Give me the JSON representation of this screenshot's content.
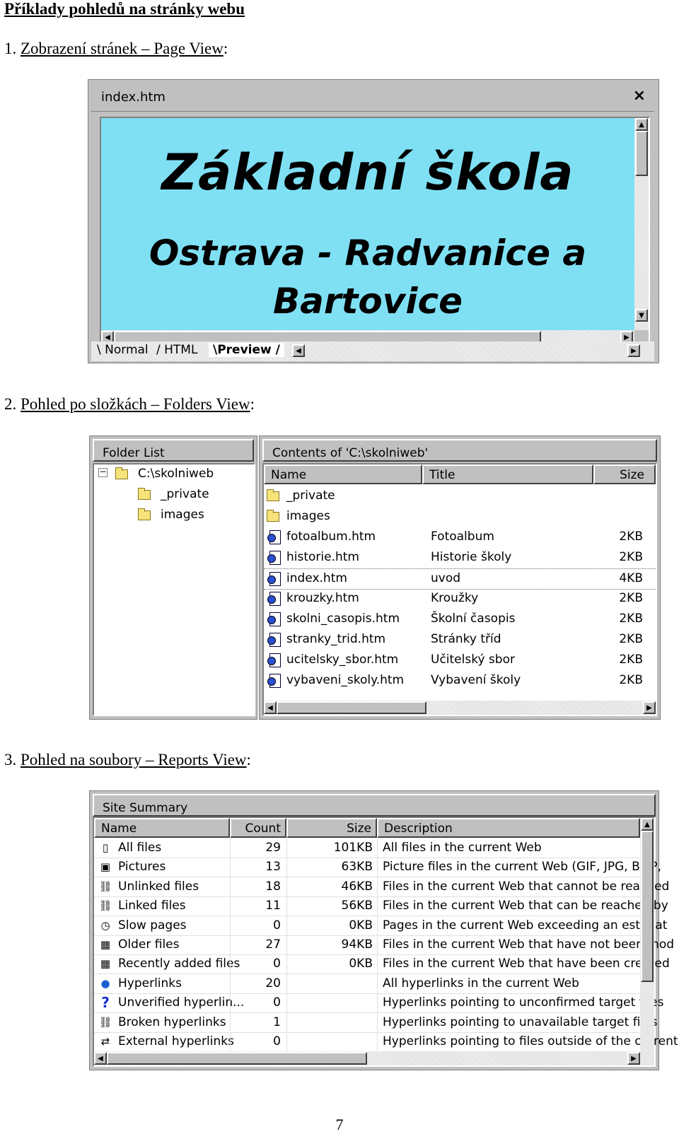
{
  "doc_title": "Příklady pohledů na stránky webu",
  "sections": [
    {
      "num": "1. ",
      "label": "Zobrazení stránek – Page View",
      "suffix": ":"
    },
    {
      "num": "2. ",
      "label": "Pohled po složkách – Folders View",
      "suffix": ":"
    },
    {
      "num": "3. ",
      "label": "Pohled na soubory – Reports View",
      "suffix": ":"
    }
  ],
  "page_view": {
    "window_title": "index.htm",
    "close_glyph": "×",
    "heading": "Základní škola",
    "line2": "Ostrava - Radvanice a",
    "line3": "Bartovice",
    "background_color": "#7fe0f4",
    "tabs": [
      "Normal",
      "HTML",
      "Preview"
    ],
    "active_tab": "Preview"
  },
  "folders_view": {
    "folder_list_title": "Folder List",
    "root": "C:\\skolniweb",
    "tree": [
      "_private",
      "images"
    ],
    "contents_title": "Contents of 'C:\\skolniweb'",
    "columns": [
      "Name",
      "Title",
      "Size"
    ],
    "rows": [
      {
        "name": "_private",
        "title": "",
        "size": "",
        "kind": "folder"
      },
      {
        "name": "images",
        "title": "",
        "size": "",
        "kind": "folder"
      },
      {
        "name": "fotoalbum.htm",
        "title": "Fotoalbum",
        "size": "2KB",
        "kind": "page"
      },
      {
        "name": "historie.htm",
        "title": "Historie školy",
        "size": "2KB",
        "kind": "page"
      },
      {
        "name": "index.htm",
        "title": "uvod",
        "size": "4KB",
        "kind": "home"
      },
      {
        "name": "krouzky.htm",
        "title": "Kroužky",
        "size": "2KB",
        "kind": "page"
      },
      {
        "name": "skolni_casopis.htm",
        "title": "Školní časopis",
        "size": "2KB",
        "kind": "page"
      },
      {
        "name": "stranky_trid.htm",
        "title": "Stránky tříd",
        "size": "2KB",
        "kind": "page"
      },
      {
        "name": "ucitelsky_sbor.htm",
        "title": "Učitelský sbor",
        "size": "2KB",
        "kind": "page"
      },
      {
        "name": "vybaveni_skoly.htm",
        "title": "Vybavení školy",
        "size": "2KB",
        "kind": "page"
      }
    ]
  },
  "reports_view": {
    "title": "Site Summary",
    "columns": [
      "Name",
      "Count",
      "Size",
      "Description"
    ],
    "rows": [
      {
        "icon": "page-icon",
        "glyph": "▯",
        "name": "All files",
        "count": "29",
        "size": "101KB",
        "desc": "All files in the current Web"
      },
      {
        "icon": "picture-icon",
        "glyph": "▣",
        "name": "Pictures",
        "count": "13",
        "size": "63KB",
        "desc": "Picture files in the current Web (GIF, JPG, BMP,"
      },
      {
        "icon": "unlinked-icon",
        "glyph": "⛓",
        "name": "Unlinked files",
        "count": "18",
        "size": "46KB",
        "desc": "Files in the current Web that cannot be reached"
      },
      {
        "icon": "linked-icon",
        "glyph": "⛓",
        "name": "Linked files",
        "count": "11",
        "size": "56KB",
        "desc": "Files in the current Web that can be reached by"
      },
      {
        "icon": "clock-icon",
        "glyph": "◷",
        "name": "Slow pages",
        "count": "0",
        "size": "0KB",
        "desc": "Pages in the current Web exceeding an estimat"
      },
      {
        "icon": "calendar-icon",
        "glyph": "▦",
        "name": "Older files",
        "count": "27",
        "size": "94KB",
        "desc": "Files in the current Web that have not been mod"
      },
      {
        "icon": "calendar-icon",
        "glyph": "▦",
        "name": "Recently added files",
        "count": "0",
        "size": "0KB",
        "desc": "Files in the current Web that have been created"
      },
      {
        "icon": "globe-icon",
        "glyph": "●",
        "name": "Hyperlinks",
        "count": "20",
        "size": "",
        "desc": "All hyperlinks in the current Web"
      },
      {
        "icon": "question-icon",
        "glyph": "?",
        "name": "Unverified hyperlin...",
        "count": "0",
        "size": "",
        "desc": "Hyperlinks pointing to unconfirmed target files"
      },
      {
        "icon": "broken-link-icon",
        "glyph": "⛓",
        "name": "Broken hyperlinks",
        "count": "1",
        "size": "",
        "desc": "Hyperlinks pointing to unavailable target files"
      },
      {
        "icon": "external-link-icon",
        "glyph": "⇄",
        "name": "External hyperlinks",
        "count": "0",
        "size": "",
        "desc": "Hyperlinks pointing to files outside of the current"
      }
    ]
  },
  "page_number": "7"
}
